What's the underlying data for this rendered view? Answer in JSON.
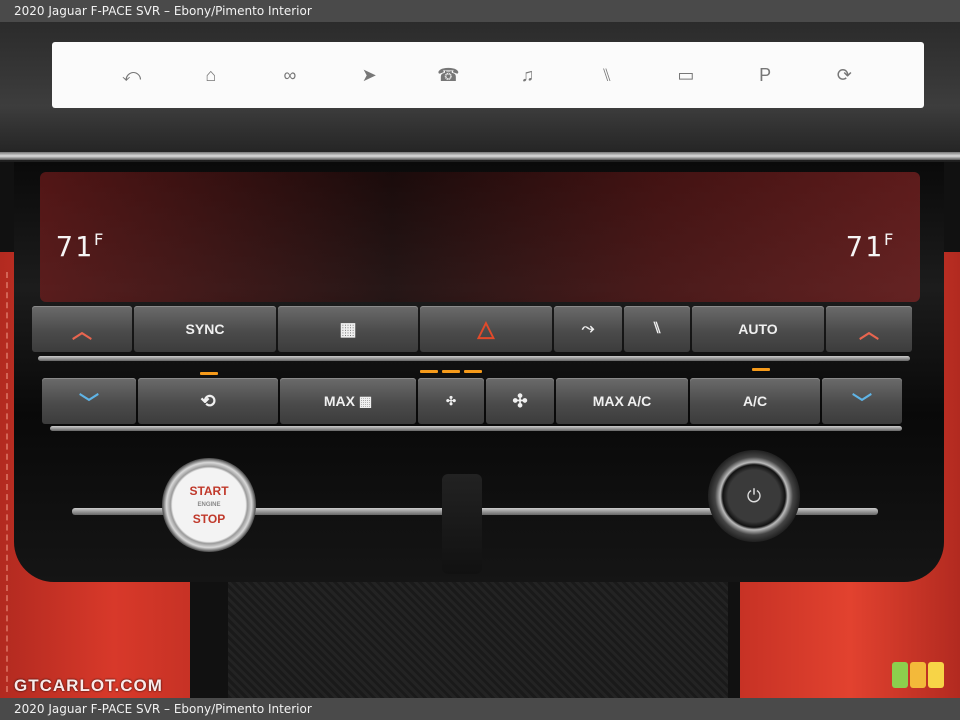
{
  "caption": "2020 Jaguar F-PACE SVR – Ebony/Pimento Interior",
  "watermark": "GTCARLOT.COM",
  "screen_icons": [
    "back-icon",
    "home-icon",
    "connect-icon",
    "navigation-icon",
    "phone-icon",
    "media-icon",
    "seat-icon",
    "camera-icon",
    "parking-icon",
    "vehicle-icon"
  ],
  "left_temp": "71",
  "right_temp": "71",
  "temp_unit": "F",
  "row1": {
    "sync": "SYNC",
    "auto": "AUTO"
  },
  "row2": {
    "max": "MAX",
    "max_ac": "MAX A/C",
    "ac": "A/C"
  },
  "start": {
    "top": "START",
    "mid": "ENGINE",
    "bottom": "STOP"
  },
  "colors": {
    "leather": "#d8392a",
    "led": "#f59a1a",
    "hazard": "#e24a2a",
    "up_arrow": "#e8654f",
    "down_arrow": "#5fb4e6"
  }
}
